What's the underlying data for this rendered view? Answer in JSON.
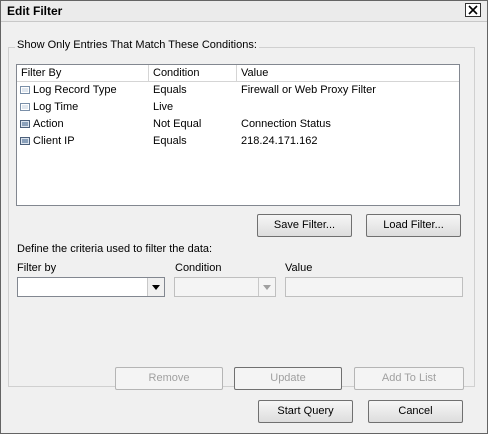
{
  "window": {
    "title": "Edit Filter"
  },
  "group": {
    "legend": "Show Only Entries That Match These Conditions:"
  },
  "list": {
    "columns": [
      "Filter By",
      "Condition",
      "Value"
    ],
    "rows": [
      {
        "filter_by": "Log Record Type",
        "condition": "Equals",
        "value": "Firewall or Web Proxy Filter"
      },
      {
        "filter_by": "Log Time",
        "condition": "Live",
        "value": ""
      },
      {
        "filter_by": "Action",
        "condition": "Not Equal",
        "value": "Connection Status"
      },
      {
        "filter_by": "Client IP",
        "condition": "Equals",
        "value": "218.24.171.162"
      }
    ]
  },
  "buttons": {
    "save_filter": "Save Filter...",
    "load_filter": "Load Filter...",
    "remove": "Remove",
    "update": "Update",
    "add_to_list": "Add To List",
    "start_query": "Start Query",
    "cancel": "Cancel"
  },
  "criteria": {
    "instruction": "Define the criteria used to filter the data:",
    "filter_by_label": "Filter by",
    "condition_label": "Condition",
    "value_label": "Value",
    "filter_by_value": "",
    "condition_value": "",
    "value_value": ""
  },
  "icons": {
    "close": "close-icon",
    "row": "filter-item-icon",
    "dropdown": "chevron-down-icon"
  },
  "colors": {
    "window_bg": "#f0f0f0",
    "list_bg": "#ffffff",
    "disabled_text": "#a0a0a0"
  }
}
